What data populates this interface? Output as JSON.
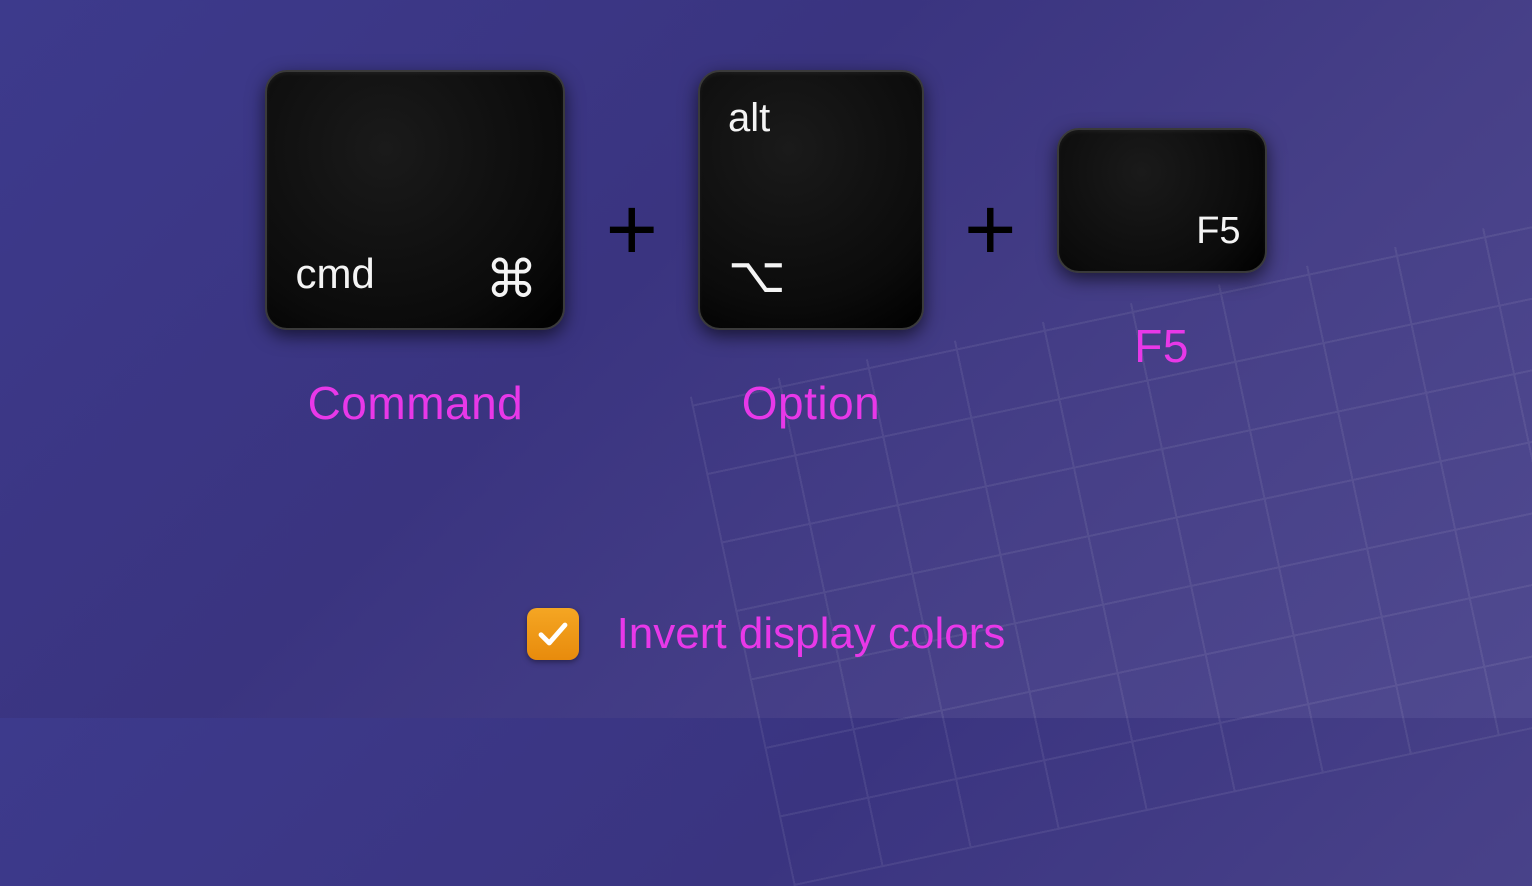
{
  "keys": {
    "command": {
      "key_text": "cmd",
      "symbol": "⌘",
      "label": "Command"
    },
    "option": {
      "key_text": "alt",
      "symbol": "⌥",
      "label": "Option"
    },
    "f5": {
      "key_text": "F5",
      "label": "F5"
    }
  },
  "separators": {
    "plus": "+"
  },
  "checkbox": {
    "checked": true,
    "label": "Invert display colors"
  },
  "colors": {
    "accent_text": "#e838e8",
    "checkbox_bg": "#e88b0c"
  }
}
